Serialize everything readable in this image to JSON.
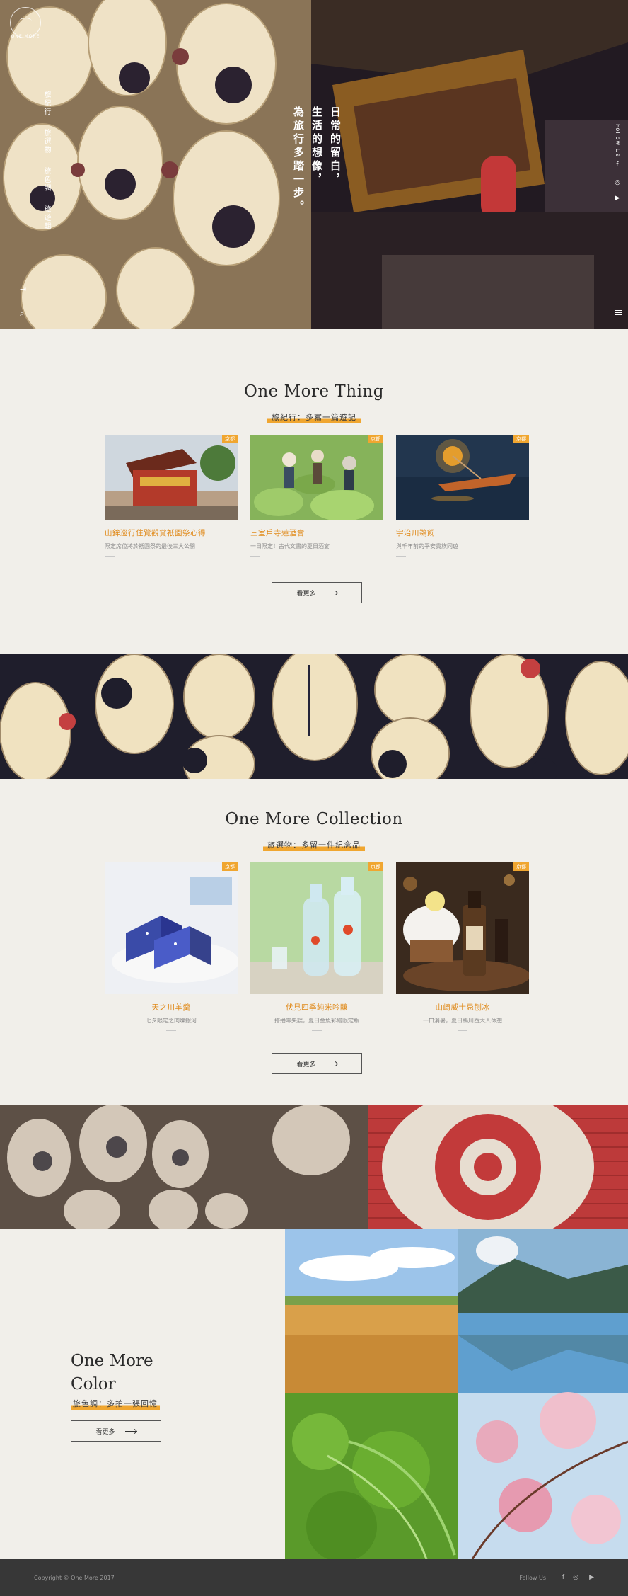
{
  "hero": {
    "logo_text": "ONE MORE",
    "nav": [
      "旅紀行",
      "旅選物",
      "旅色調",
      "旅遊輯"
    ],
    "tagline": [
      "日常的留白，",
      "生活的想像，",
      "為旅行多踏一步。"
    ],
    "follow": "Follow Us",
    "social_icons": [
      "facebook-icon",
      "instagram-icon",
      "youtube-icon"
    ]
  },
  "thing": {
    "title": "One More Thing",
    "subtitle": "旅紀行：多寫一篇遊記",
    "cards": [
      {
        "tag": "京都",
        "title": "山鉾巡行住覽觀賞祇園祭心得",
        "desc": "限定席位將於祇園祭的最後三大公開"
      },
      {
        "tag": "京都",
        "title": "三室戶寺蓮酒會",
        "desc": "一日限定！古代文書的夏日酒宴"
      },
      {
        "tag": "京都",
        "title": "宇治川鵜飼",
        "desc": "與千年前的平安貴族同遊"
      }
    ],
    "more": "看更多"
  },
  "collection": {
    "title": "One More Collection",
    "subtitle": "旅選物：多留一件紀念品",
    "cards": [
      {
        "tag": "京都",
        "title": "天之川羊羹",
        "desc": "七夕限定之閃爍銀河"
      },
      {
        "tag": "京都",
        "title": "伏見四季純米吟釀",
        "desc": "搭播零失誤，夏日金魚彩繪限定瓶"
      },
      {
        "tag": "京都",
        "title": "山崎威士忌刨冰",
        "desc": "一口消暑，夏日鴨川西大人休憩"
      }
    ],
    "more": "看更多"
  },
  "color": {
    "title_lines": [
      "One More",
      "Color"
    ],
    "subtitle": "旅色調：多拍一張回憶",
    "more": "看更多"
  },
  "footer": {
    "copyright": "Copyright © One More 2017",
    "follow": "Follow Us"
  },
  "colors": {
    "accent": "#f0a630",
    "background": "#f1efea",
    "footer": "#373737"
  }
}
